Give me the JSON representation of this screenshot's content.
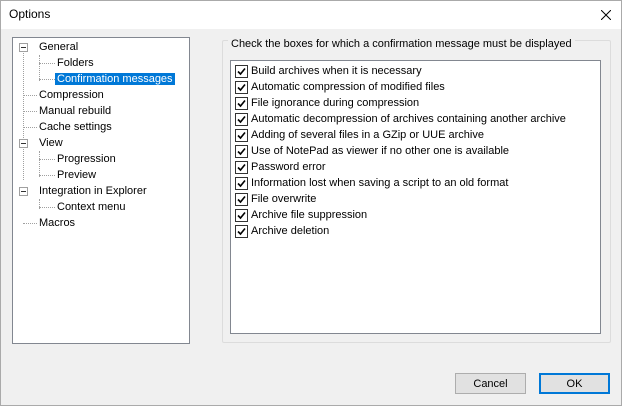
{
  "window": {
    "title": "Options"
  },
  "tree": {
    "items": [
      {
        "label": "General"
      },
      {
        "label": "Folders"
      },
      {
        "label": "Confirmation messages"
      },
      {
        "label": "Compression"
      },
      {
        "label": "Manual rebuild"
      },
      {
        "label": "Cache settings"
      },
      {
        "label": "View"
      },
      {
        "label": "Progression"
      },
      {
        "label": "Preview"
      },
      {
        "label": "Integration in Explorer"
      },
      {
        "label": "Context menu"
      },
      {
        "label": "Macros"
      }
    ]
  },
  "confirmations": {
    "group_title": "Check the boxes for which a confirmation message must be displayed",
    "items": [
      {
        "label": "Build archives when it is necessary",
        "checked": true
      },
      {
        "label": "Automatic compression of modified files",
        "checked": true
      },
      {
        "label": "File ignorance during compression",
        "checked": true
      },
      {
        "label": "Automatic decompression of archives containing another archive",
        "checked": true
      },
      {
        "label": "Adding of several files in a GZip or UUE archive",
        "checked": true
      },
      {
        "label": "Use of NotePad as viewer if no other one is available",
        "checked": true
      },
      {
        "label": "Password error",
        "checked": true
      },
      {
        "label": "Information lost when saving a script to an old format",
        "checked": true
      },
      {
        "label": "File overwrite",
        "checked": true
      },
      {
        "label": "Archive file suppression",
        "checked": true
      },
      {
        "label": "Archive deletion",
        "checked": true
      }
    ]
  },
  "buttons": {
    "cancel": "Cancel",
    "ok": "OK"
  },
  "icons": {
    "close": "close-icon",
    "expander": "tree-collapse-icon",
    "check": "checkmark-icon"
  },
  "colors": {
    "selection": "#0078d7",
    "default_button_border": "#0078d7"
  }
}
